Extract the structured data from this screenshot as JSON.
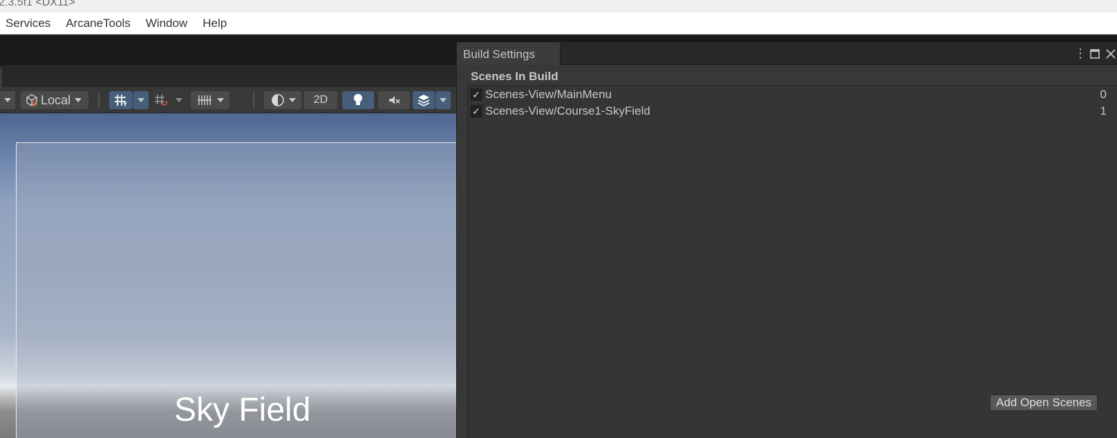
{
  "window": {
    "title": "2.3.5f1 <DX11>"
  },
  "menu": {
    "items": [
      "Services",
      "ArcaneTools",
      "Window",
      "Help"
    ]
  },
  "scene_toolbar": {
    "pivot_rotation_label": "Local",
    "mode_2d_label": "2D"
  },
  "viewport": {
    "game_title": "Sky Field"
  },
  "build_settings": {
    "tab_title": "Build Settings",
    "section_label": "Scenes In Build",
    "scenes": [
      {
        "name": "Scenes-View/MainMenu",
        "index": "0",
        "checked": true
      },
      {
        "name": "Scenes-View/Course1-SkyField",
        "index": "1",
        "checked": true
      }
    ],
    "add_open_scenes_label": "Add Open Scenes"
  }
}
